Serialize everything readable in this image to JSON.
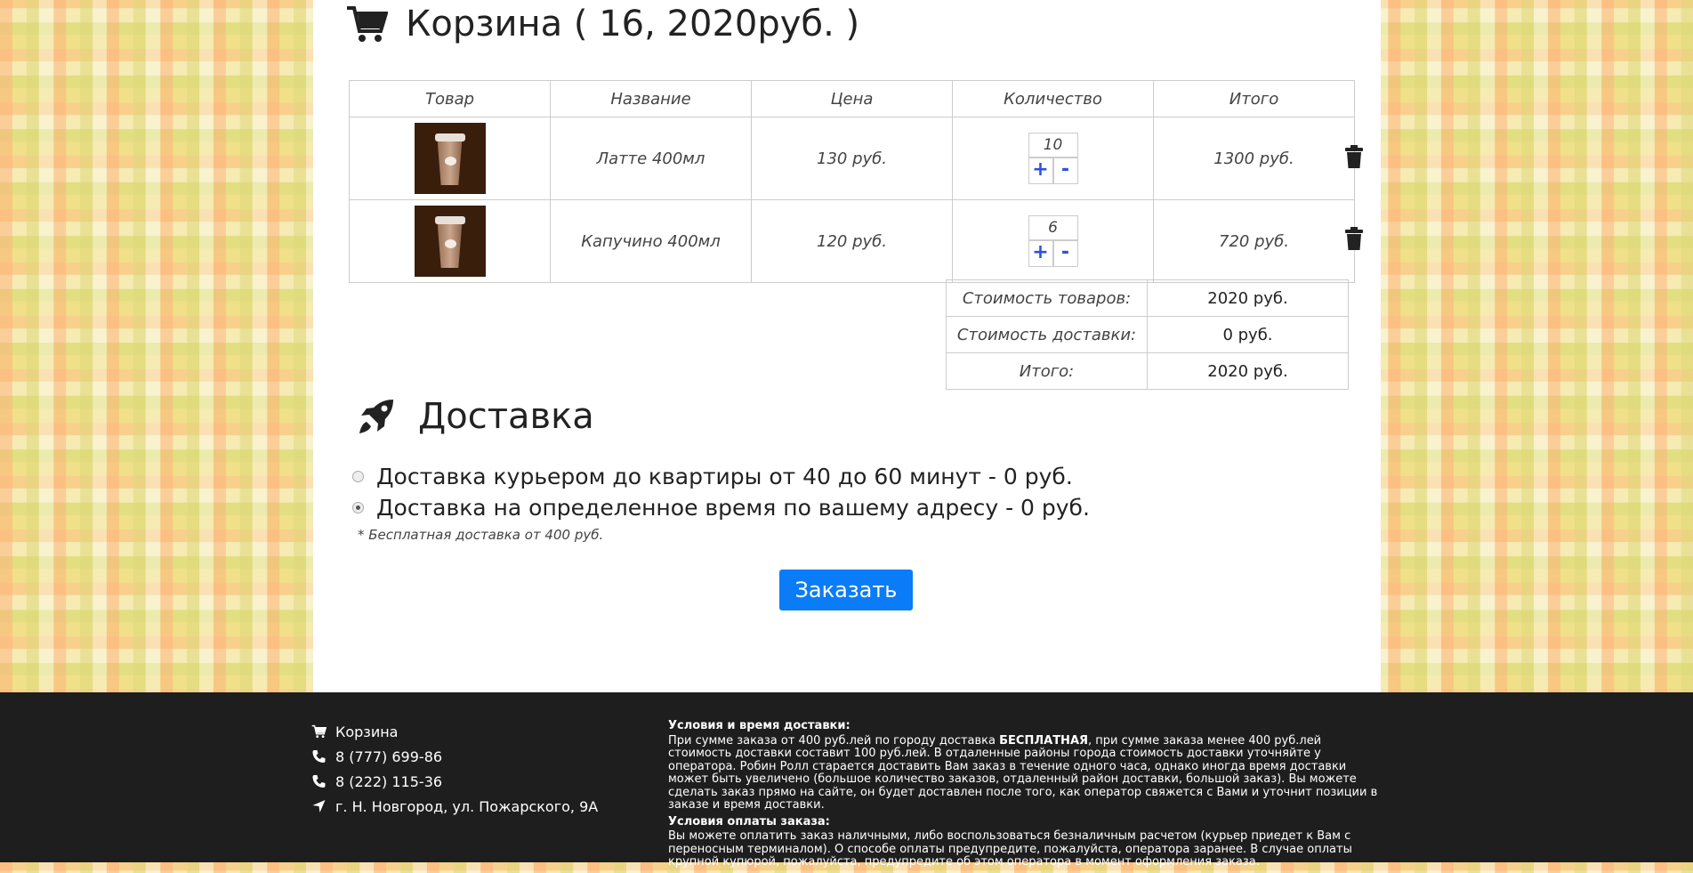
{
  "cart": {
    "title": "Корзина ( 16, 2020руб. )",
    "headers": [
      "Товар",
      "Название",
      "Цена",
      "Количество",
      "Итого"
    ],
    "items": [
      {
        "name": "Латте 400мл",
        "price": "130 руб.",
        "qty": "10",
        "total": "1300 руб."
      },
      {
        "name": "Капучино 400мл",
        "price": "120 руб.",
        "qty": "6",
        "total": "720 руб."
      }
    ],
    "plus": "+",
    "minus": "-",
    "summary": [
      {
        "label": "Стоимость товаров:",
        "value": "2020 руб."
      },
      {
        "label": "Стоимость доставки:",
        "value": "0 руб."
      },
      {
        "label": "Итого:",
        "value": "2020 руб."
      }
    ]
  },
  "delivery": {
    "title": "Доставка",
    "options": [
      {
        "label": "Доставка курьером до квартиры от 40 до 60 минут - 0 руб.",
        "selected": false
      },
      {
        "label": "Доставка на определенное время по вашему адресу - 0 руб.",
        "selected": true
      }
    ],
    "note": "* Бесплатная доставка от 400 руб.",
    "order_button": "Заказать"
  },
  "footer": {
    "cart_link": "Корзина",
    "phone1": "8 (777) 699-86",
    "phone2": "8 (222) 115-36",
    "address": "г. Н. Новгород, ул. Пожарского, 9А",
    "delivery_heading": "Условия и время доставки:",
    "delivery_text_1": "При сумме заказа от 400 руб.лей по городу доставка ",
    "delivery_text_bold": "БЕСПЛАТНАЯ",
    "delivery_text_2": ", при сумме заказа менее 400 руб.лей стоимость доставки составит 100 руб.лей. В отдаленные районы города стоимость доставки уточняйте у оператора. Робин Ролл старается доставить Вам заказ в течение одного часа, однако иногда время доставки может быть увеличено (большое количество заказов, отдаленный район доставки, большой заказ). Вы можете сделать заказ прямо на сайте, он будет доставлен после того, как оператор свяжется с Вами и уточнит позиции в заказе и время доставки.",
    "payment_heading": "Условия оплаты заказа:",
    "payment_text": "Вы можете оплатить заказ наличными, либо воспользоваться безналичным расчетом (курьер приедет к Вам с переносным терминалом). О способе оплаты предупредите, пожалуйста, оператора заранее. В случае оплаты крупной купюрой, пожалуйста, предупредите об этом оператора в момент оформления заказа."
  },
  "colors": {
    "accent": "#0a7cf8",
    "footer_bg": "#1e1e1e",
    "qty_button": "#3050e0"
  }
}
